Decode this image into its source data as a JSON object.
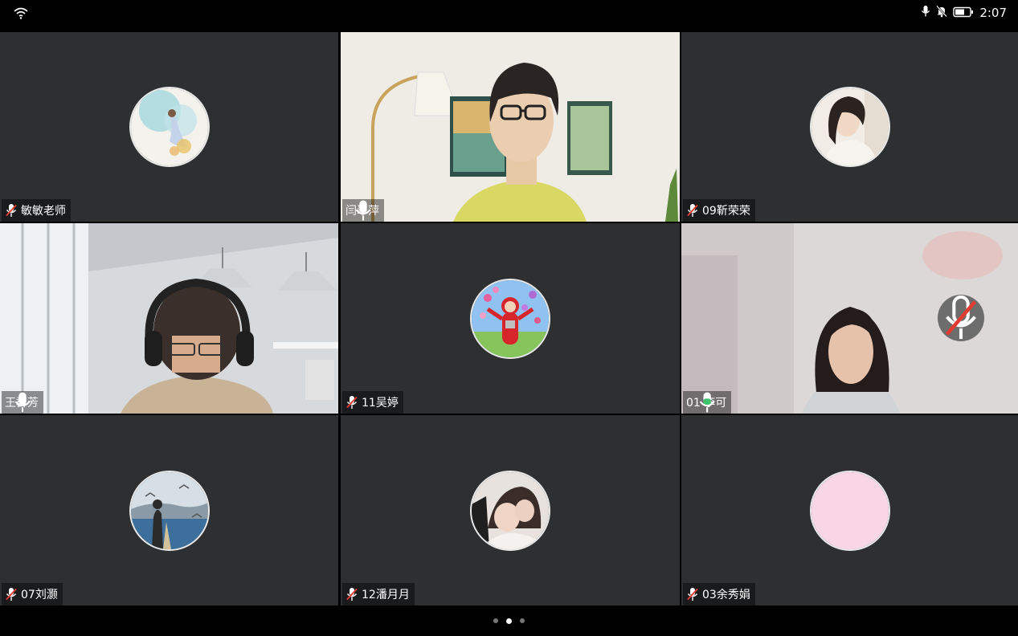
{
  "status_bar": {
    "time": "2:07",
    "icons": [
      "wifi-icon",
      "mic-icon",
      "bell-muted-icon",
      "battery-icon"
    ],
    "battery_level": 0.6
  },
  "participants": [
    {
      "name": "敏敏老师",
      "mic": "muted",
      "media": "avatar-watercolor"
    },
    {
      "name": "闫翠萍",
      "mic": "on",
      "media": "video"
    },
    {
      "name": "09靳荣荣",
      "mic": "muted",
      "media": "avatar-portrait"
    },
    {
      "name": "王群芳",
      "mic": "on",
      "media": "video"
    },
    {
      "name": "11吴婷",
      "mic": "muted",
      "media": "avatar-teletubby"
    },
    {
      "name": "01 李可",
      "mic": "speaking",
      "media": "video",
      "active": true
    },
    {
      "name": "07刘灏",
      "mic": "muted",
      "media": "avatar-seaside"
    },
    {
      "name": "12潘月月",
      "mic": "muted",
      "media": "avatar-photo"
    },
    {
      "name": "03余秀娟",
      "mic": "muted",
      "media": "avatar-pink"
    }
  ],
  "pager": {
    "pages": 3,
    "current": 2
  },
  "colors": {
    "muted": "#e03c31",
    "speaking": "#3ec46d",
    "tile_bg": "#2d2f31"
  }
}
